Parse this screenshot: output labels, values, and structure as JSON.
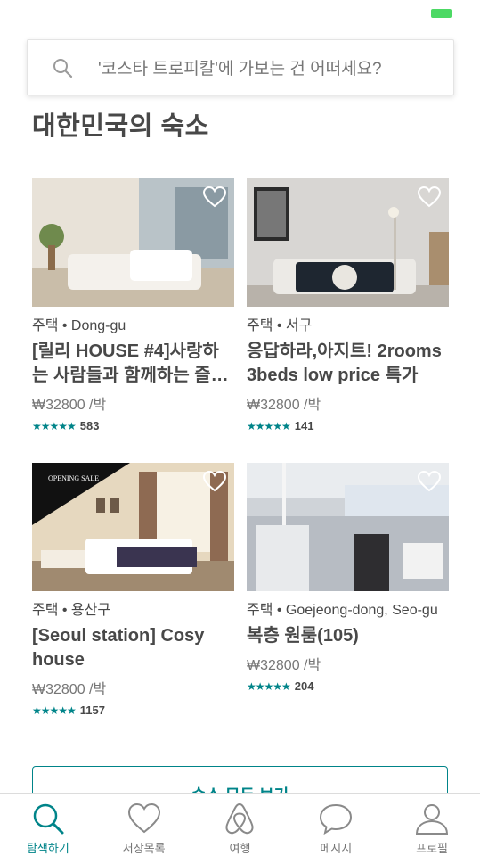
{
  "search": {
    "placeholder": "'코스타 트로피칼'에 가보는 건 어떠세요?"
  },
  "section_title": "대한민국의 숙소",
  "listings": [
    {
      "meta": "주택 • Dong-gu",
      "name": "[릴리 HOUSE #4]사랑하는 사람들과 함께하는 즐…",
      "price": "₩32800 /박",
      "stars": "★★★★★",
      "reviews": "583"
    },
    {
      "meta": "주택 • 서구",
      "name": "응답하라,아지트! 2rooms 3beds low price 특가",
      "price": "₩32800 /박",
      "stars": "★★★★★",
      "reviews": "141"
    },
    {
      "meta": "주택 • 용산구",
      "name": "[Seoul station] Cosy house",
      "price": "₩32800 /박",
      "stars": "★★★★★",
      "reviews": "1157",
      "photo_badge": "OPENING SALE"
    },
    {
      "meta": "주택 • Goejeong-dong, Seo-gu",
      "name": "복층 원룸(105)",
      "price": "₩32800 /박",
      "stars": "★★★★★",
      "reviews": "204"
    }
  ],
  "see_all_label": "숙소 모두 보기",
  "tabs": [
    {
      "label": "탐색하기",
      "icon": "search-icon",
      "active": true
    },
    {
      "label": "저장목록",
      "icon": "heart-icon",
      "active": false
    },
    {
      "label": "여행",
      "icon": "airbnb-logo-icon",
      "active": false
    },
    {
      "label": "메시지",
      "icon": "message-icon",
      "active": false
    },
    {
      "label": "프로필",
      "icon": "profile-icon",
      "active": false
    }
  ],
  "colors": {
    "accent": "#008489",
    "text": "#484848",
    "battery": "#4cd964"
  }
}
